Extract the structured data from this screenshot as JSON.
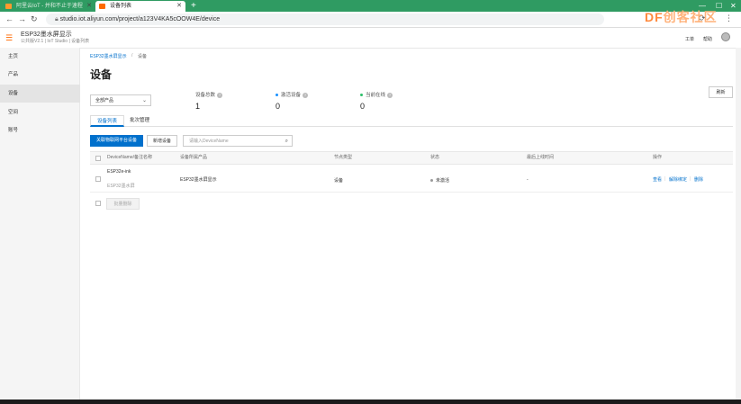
{
  "browser": {
    "tabs": [
      {
        "title": "阿里云IoT - 并和不止于速程"
      },
      {
        "title": "设备列表"
      }
    ],
    "url": "studio.iot.aliyun.com/project/a123V4KA5cOOW4E/device",
    "brand": {
      "text": "DF创客社区",
      "main": "DF",
      "rest": "创客社区"
    }
  },
  "header": {
    "project_title": "ESP32墨水屏显示",
    "project_sub": "公共版V2.1 | IoT Studio | 设备列表",
    "links": [
      "工单",
      "帮助"
    ]
  },
  "sidebar": {
    "items": [
      {
        "label": "主页"
      },
      {
        "label": "产品"
      },
      {
        "label": "设备"
      },
      {
        "label": "空间"
      },
      {
        "label": "账号"
      }
    ]
  },
  "breadcrumb": {
    "parent": "ESP32墨水屏显示",
    "separator": "/",
    "current": "设备"
  },
  "page": {
    "title": "设备",
    "product_select": "全部产品",
    "refresh_label": "刷新",
    "stats": [
      {
        "label": "设备总数",
        "value": "1"
      },
      {
        "label": "激活设备",
        "value": "0"
      },
      {
        "label": "当前在线",
        "value": "0"
      }
    ],
    "tabs": [
      "设备列表",
      "批次管理"
    ],
    "toolbar": {
      "primary_label": "关联物联网平台设备",
      "new_label": "新增设备",
      "search_placeholder": "请输入DeviceName"
    },
    "table": {
      "columns": [
        "DeviceName/备注名称",
        "设备所属产品",
        "节点类型",
        "状态",
        "最后上线时间",
        "操作"
      ],
      "rows": [
        {
          "device_name": "ESP32e-ink",
          "remark": "ESP32墨水屏",
          "product": "ESP32墨水屏显示",
          "node_type": "设备",
          "status": "未激活",
          "last_online": "-",
          "actions": [
            "查看",
            "解除绑定",
            "删除"
          ]
        }
      ],
      "batch_delete": "批量删除"
    }
  },
  "colors": {
    "accent": "#0070cc",
    "brand_orange": "#ff6a00",
    "browser_tab": "#2f9b62",
    "status_inactive": "#999999",
    "status_active": "#1890ff",
    "status_online": "#2dbf6a"
  }
}
